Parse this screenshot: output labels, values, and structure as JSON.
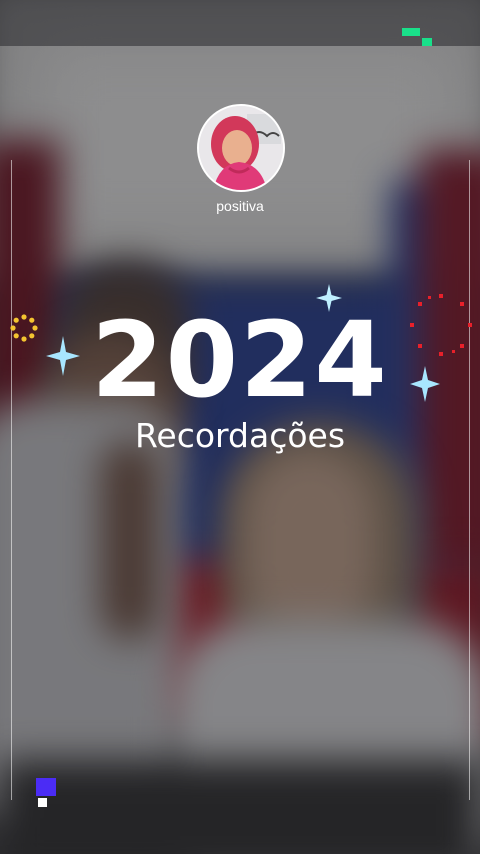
{
  "profile": {
    "username": "positiva"
  },
  "title": {
    "year": "2024",
    "subtitle": "Recordações"
  },
  "colors": {
    "overlay_text": "#ffffff",
    "green_accent": "#19e08a",
    "yellow_accent": "#f4c430",
    "red_accent": "#e8202a",
    "purple_accent": "#4b2cf5",
    "sparkle_blue": "#9fe3ff"
  },
  "icons": {
    "top_right": "pixel-progress-icon",
    "left_ring": "dotted-ring-icon",
    "right_ring": "firework-ring-icon",
    "bottom_left": "pixel-square-icon",
    "sparkles": "four-point-star-icon"
  }
}
